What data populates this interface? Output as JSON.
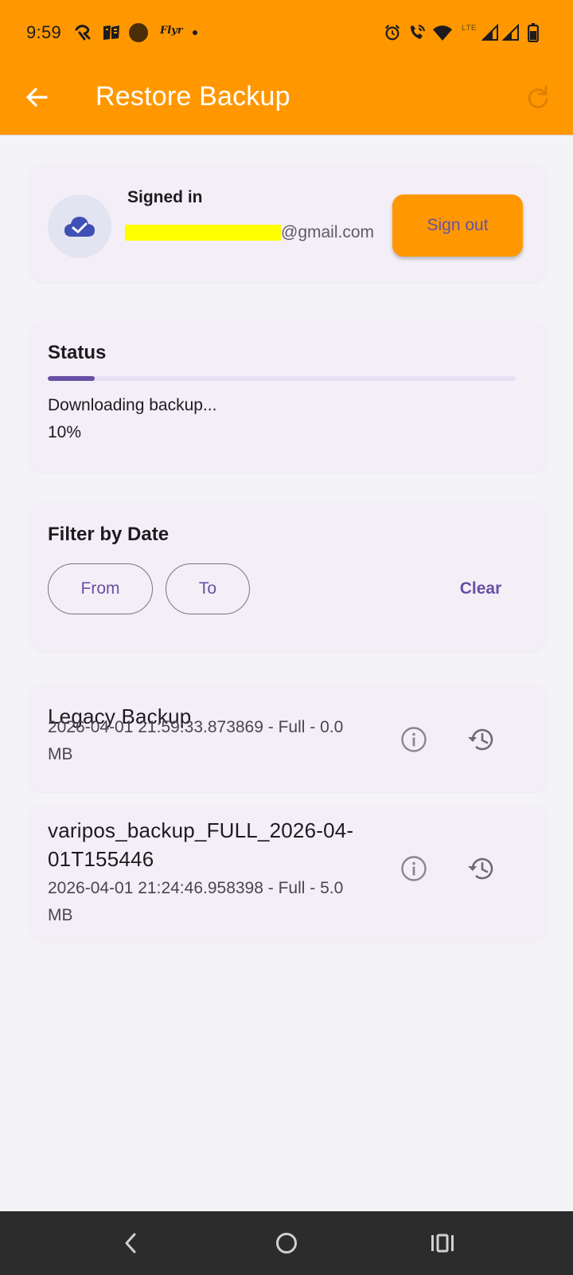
{
  "status_bar": {
    "time": "9:59",
    "app_label": "Flyr",
    "network_label": "LTE"
  },
  "toolbar": {
    "title": "Restore Backup",
    "back_icon": "arrow-back-icon",
    "refresh_icon": "refresh-icon"
  },
  "account": {
    "label": "Signed in",
    "email_visible": "@gmail.com",
    "avatar_icon": "cloud-done-icon",
    "sign_out_label": "Sign out"
  },
  "status": {
    "title": "Status",
    "message": "Downloading backup...",
    "percent_text": "10%",
    "progress": 0.1
  },
  "filter": {
    "title": "Filter by Date",
    "from_label": "From",
    "to_label": "To",
    "clear_label": "Clear"
  },
  "backups": [
    {
      "name": "Legacy Backup",
      "meta": "2026-04-01 21:59:33.873869 - Full - 0.0 MB",
      "info_icon": "info-icon",
      "restore_icon": "restore-history-icon"
    },
    {
      "name": "varipos_backup_FULL_2026-04-01T155446",
      "meta": "2026-04-01 21:24:46.958398 - Full - 5.0 MB",
      "info_icon": "info-icon",
      "restore_icon": "restore-history-icon"
    }
  ],
  "colors": {
    "app_bar": "#ff9800",
    "accent": "#6750a4",
    "card": "#f4eff7",
    "background": "#f4f3f5"
  }
}
